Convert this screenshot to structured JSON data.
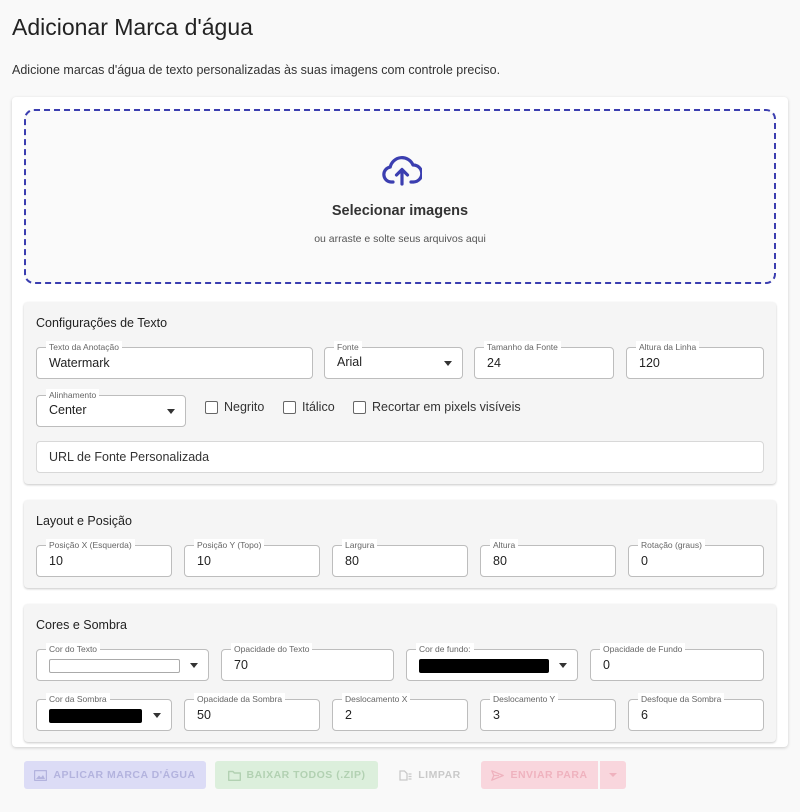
{
  "page": {
    "title": "Adicionar Marca d'água",
    "subtitle": "Adicione marcas d'água de texto personalizadas às suas imagens com controle preciso."
  },
  "dropzone": {
    "icon": "cloud-upload-icon",
    "title": "Selecionar imagens",
    "subtitle": "ou arraste e solte seus arquivos aqui"
  },
  "text_settings": {
    "title": "Configurações de Texto",
    "annotation_text": {
      "label": "Texto da Anotação",
      "value": "Watermark"
    },
    "font": {
      "label": "Fonte",
      "value": "Arial"
    },
    "font_size": {
      "label": "Tamanho da Fonte",
      "value": "24"
    },
    "line_height": {
      "label": "Altura da Linha",
      "value": "120"
    },
    "alignment": {
      "label": "Alinhamento",
      "value": "Center"
    },
    "bold": {
      "label": "Negrito",
      "checked": false
    },
    "italic": {
      "label": "Itálico",
      "checked": false
    },
    "crop_visible": {
      "label": "Recortar em pixels visíveis",
      "checked": false
    },
    "custom_font_url": {
      "placeholder": "URL de Fonte Personalizada"
    }
  },
  "layout": {
    "title": "Layout e Posição",
    "pos_x": {
      "label": "Posição X (Esquerda)",
      "value": "10"
    },
    "pos_y": {
      "label": "Posição Y (Topo)",
      "value": "10"
    },
    "width": {
      "label": "Largura",
      "value": "80"
    },
    "height": {
      "label": "Altura",
      "value": "80"
    },
    "rotation": {
      "label": "Rotação (graus)",
      "value": "0"
    }
  },
  "colors": {
    "title": "Cores e Sombra",
    "text_color": {
      "label": "Cor do Texto",
      "value": "#ffffff"
    },
    "text_opacity": {
      "label": "Opacidade do Texto",
      "value": "70"
    },
    "bg_color": {
      "label": "Cor de fundo:",
      "value": "#000000"
    },
    "bg_opacity": {
      "label": "Opacidade de Fundo",
      "value": "0"
    },
    "shadow_color": {
      "label": "Cor da Sombra",
      "value": "#000000"
    },
    "shadow_opacity": {
      "label": "Opacidade da Sombra",
      "value": "50"
    },
    "offset_x": {
      "label": "Deslocamento X",
      "value": "2"
    },
    "offset_y": {
      "label": "Deslocamento Y",
      "value": "3"
    },
    "shadow_blur": {
      "label": "Desfoque da Sombra",
      "value": "6"
    }
  },
  "actions": {
    "apply": "APLICAR MARCA D'ÁGUA",
    "download_zip": "BAIXAR TODOS (.ZIP)",
    "clear": "LIMPAR",
    "send_to": "ENVIAR PARA"
  },
  "theme": {
    "accent": "#3b3eb0",
    "apply_disabled": "#dcdcf6",
    "zip_disabled": "#dcefdc",
    "send_disabled": "#f9d6dd"
  }
}
